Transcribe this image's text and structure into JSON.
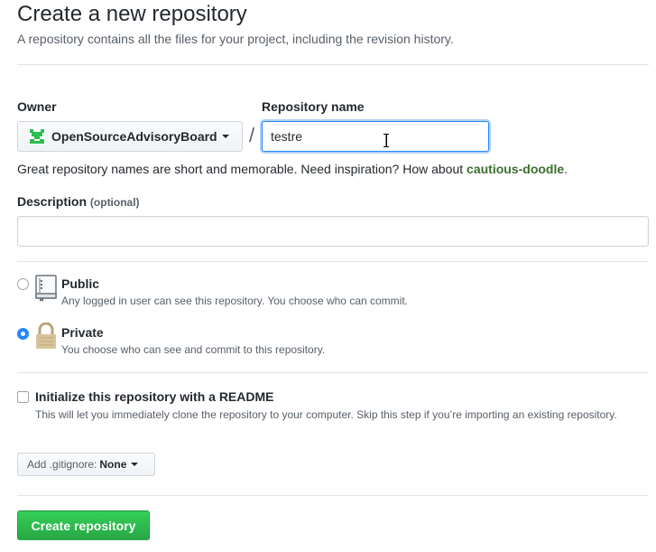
{
  "header": {
    "title": "Create a new repository",
    "subtitle": "A repository contains all the files for your project, including the revision history."
  },
  "owner": {
    "label": "Owner",
    "selected": "OpenSourceAdvisoryBoard",
    "avatar_color": "#2cbe4e"
  },
  "repo_name": {
    "label": "Repository name",
    "separator": "/",
    "value": "testre"
  },
  "hint": {
    "text": "Great repository names are short and memorable. Need inspiration? How about ",
    "suggestion": "cautious-doodle",
    "end": "."
  },
  "description": {
    "label": "Description",
    "optional": "(optional)",
    "value": ""
  },
  "visibility": {
    "selected": "private",
    "public": {
      "title": "Public",
      "note": "Any logged in user can see this repository. You choose who can commit.",
      "icon": "repo-book-icon"
    },
    "private": {
      "title": "Private",
      "note": "You choose who can see and commit to this repository.",
      "icon": "lock-icon"
    }
  },
  "readme": {
    "checked": false,
    "title": "Initialize this repository with a README",
    "note": "This will let you immediately clone the repository to your computer. Skip this step if you’re importing an existing repository."
  },
  "gitignore": {
    "label": "Add .gitignore:",
    "value": "None"
  },
  "submit": {
    "label": "Create repository",
    "color": "#28a745"
  },
  "colors": {
    "focus_blue": "#2188ff",
    "suggestion_green": "#3a6e2e"
  }
}
